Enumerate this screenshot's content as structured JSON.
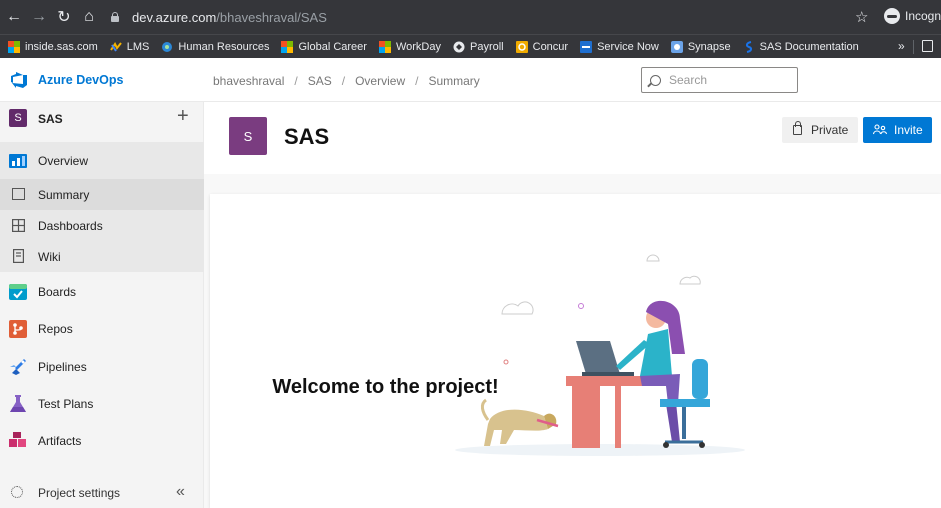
{
  "browser": {
    "url_host": "dev.azure.com",
    "url_path": "/bhaveshraval/SAS",
    "incognito_label": "Incogni",
    "bookmarks": [
      {
        "label": "inside.sas.com",
        "icon": "ms-logo-icon"
      },
      {
        "label": "LMS",
        "icon": "lms-icon"
      },
      {
        "label": "Human Resources",
        "icon": "hr-icon"
      },
      {
        "label": "Global Career",
        "icon": "ms-logo-icon"
      },
      {
        "label": "WorkDay",
        "icon": "ms-logo-icon"
      },
      {
        "label": "Payroll",
        "icon": "payroll-icon"
      },
      {
        "label": "Concur",
        "icon": "concur-icon"
      },
      {
        "label": "Service Now",
        "icon": "servicenow-icon"
      },
      {
        "label": "Synapse",
        "icon": "synapse-icon"
      },
      {
        "label": "SAS Documentation",
        "icon": "sas-icon"
      }
    ],
    "more_label": "»"
  },
  "header": {
    "app_title": "Azure DevOps",
    "breadcrumb": [
      "bhaveshraval",
      "SAS",
      "Overview",
      "Summary"
    ],
    "search_placeholder": "Search"
  },
  "sidebar": {
    "project_initial": "S",
    "project_name": "SAS",
    "add_label": "+",
    "items": [
      {
        "label": "Overview",
        "icon": "overview-icon",
        "color": "#0078d4"
      },
      {
        "label": "Summary",
        "icon": "summary-icon"
      },
      {
        "label": "Dashboards",
        "icon": "dashboards-icon"
      },
      {
        "label": "Wiki",
        "icon": "wiki-icon"
      },
      {
        "label": "Boards",
        "icon": "boards-icon",
        "color": "#009ccc"
      },
      {
        "label": "Repos",
        "icon": "repos-icon",
        "color": "#e05e37"
      },
      {
        "label": "Pipelines",
        "icon": "pipelines-icon",
        "color": "#2c7be5"
      },
      {
        "label": "Test Plans",
        "icon": "test-plans-icon",
        "color": "#8661c5"
      },
      {
        "label": "Artifacts",
        "icon": "artifacts-icon",
        "color": "#cb2e6d"
      }
    ],
    "settings_label": "Project settings",
    "collapse_label": "«"
  },
  "main": {
    "project_initial": "S",
    "project_title": "SAS",
    "private_label": "Private",
    "invite_label": "Invite",
    "welcome_title": "Welcome to the project!"
  },
  "colors": {
    "accent": "#0078d4",
    "project_avatar": "#7a3c80"
  }
}
